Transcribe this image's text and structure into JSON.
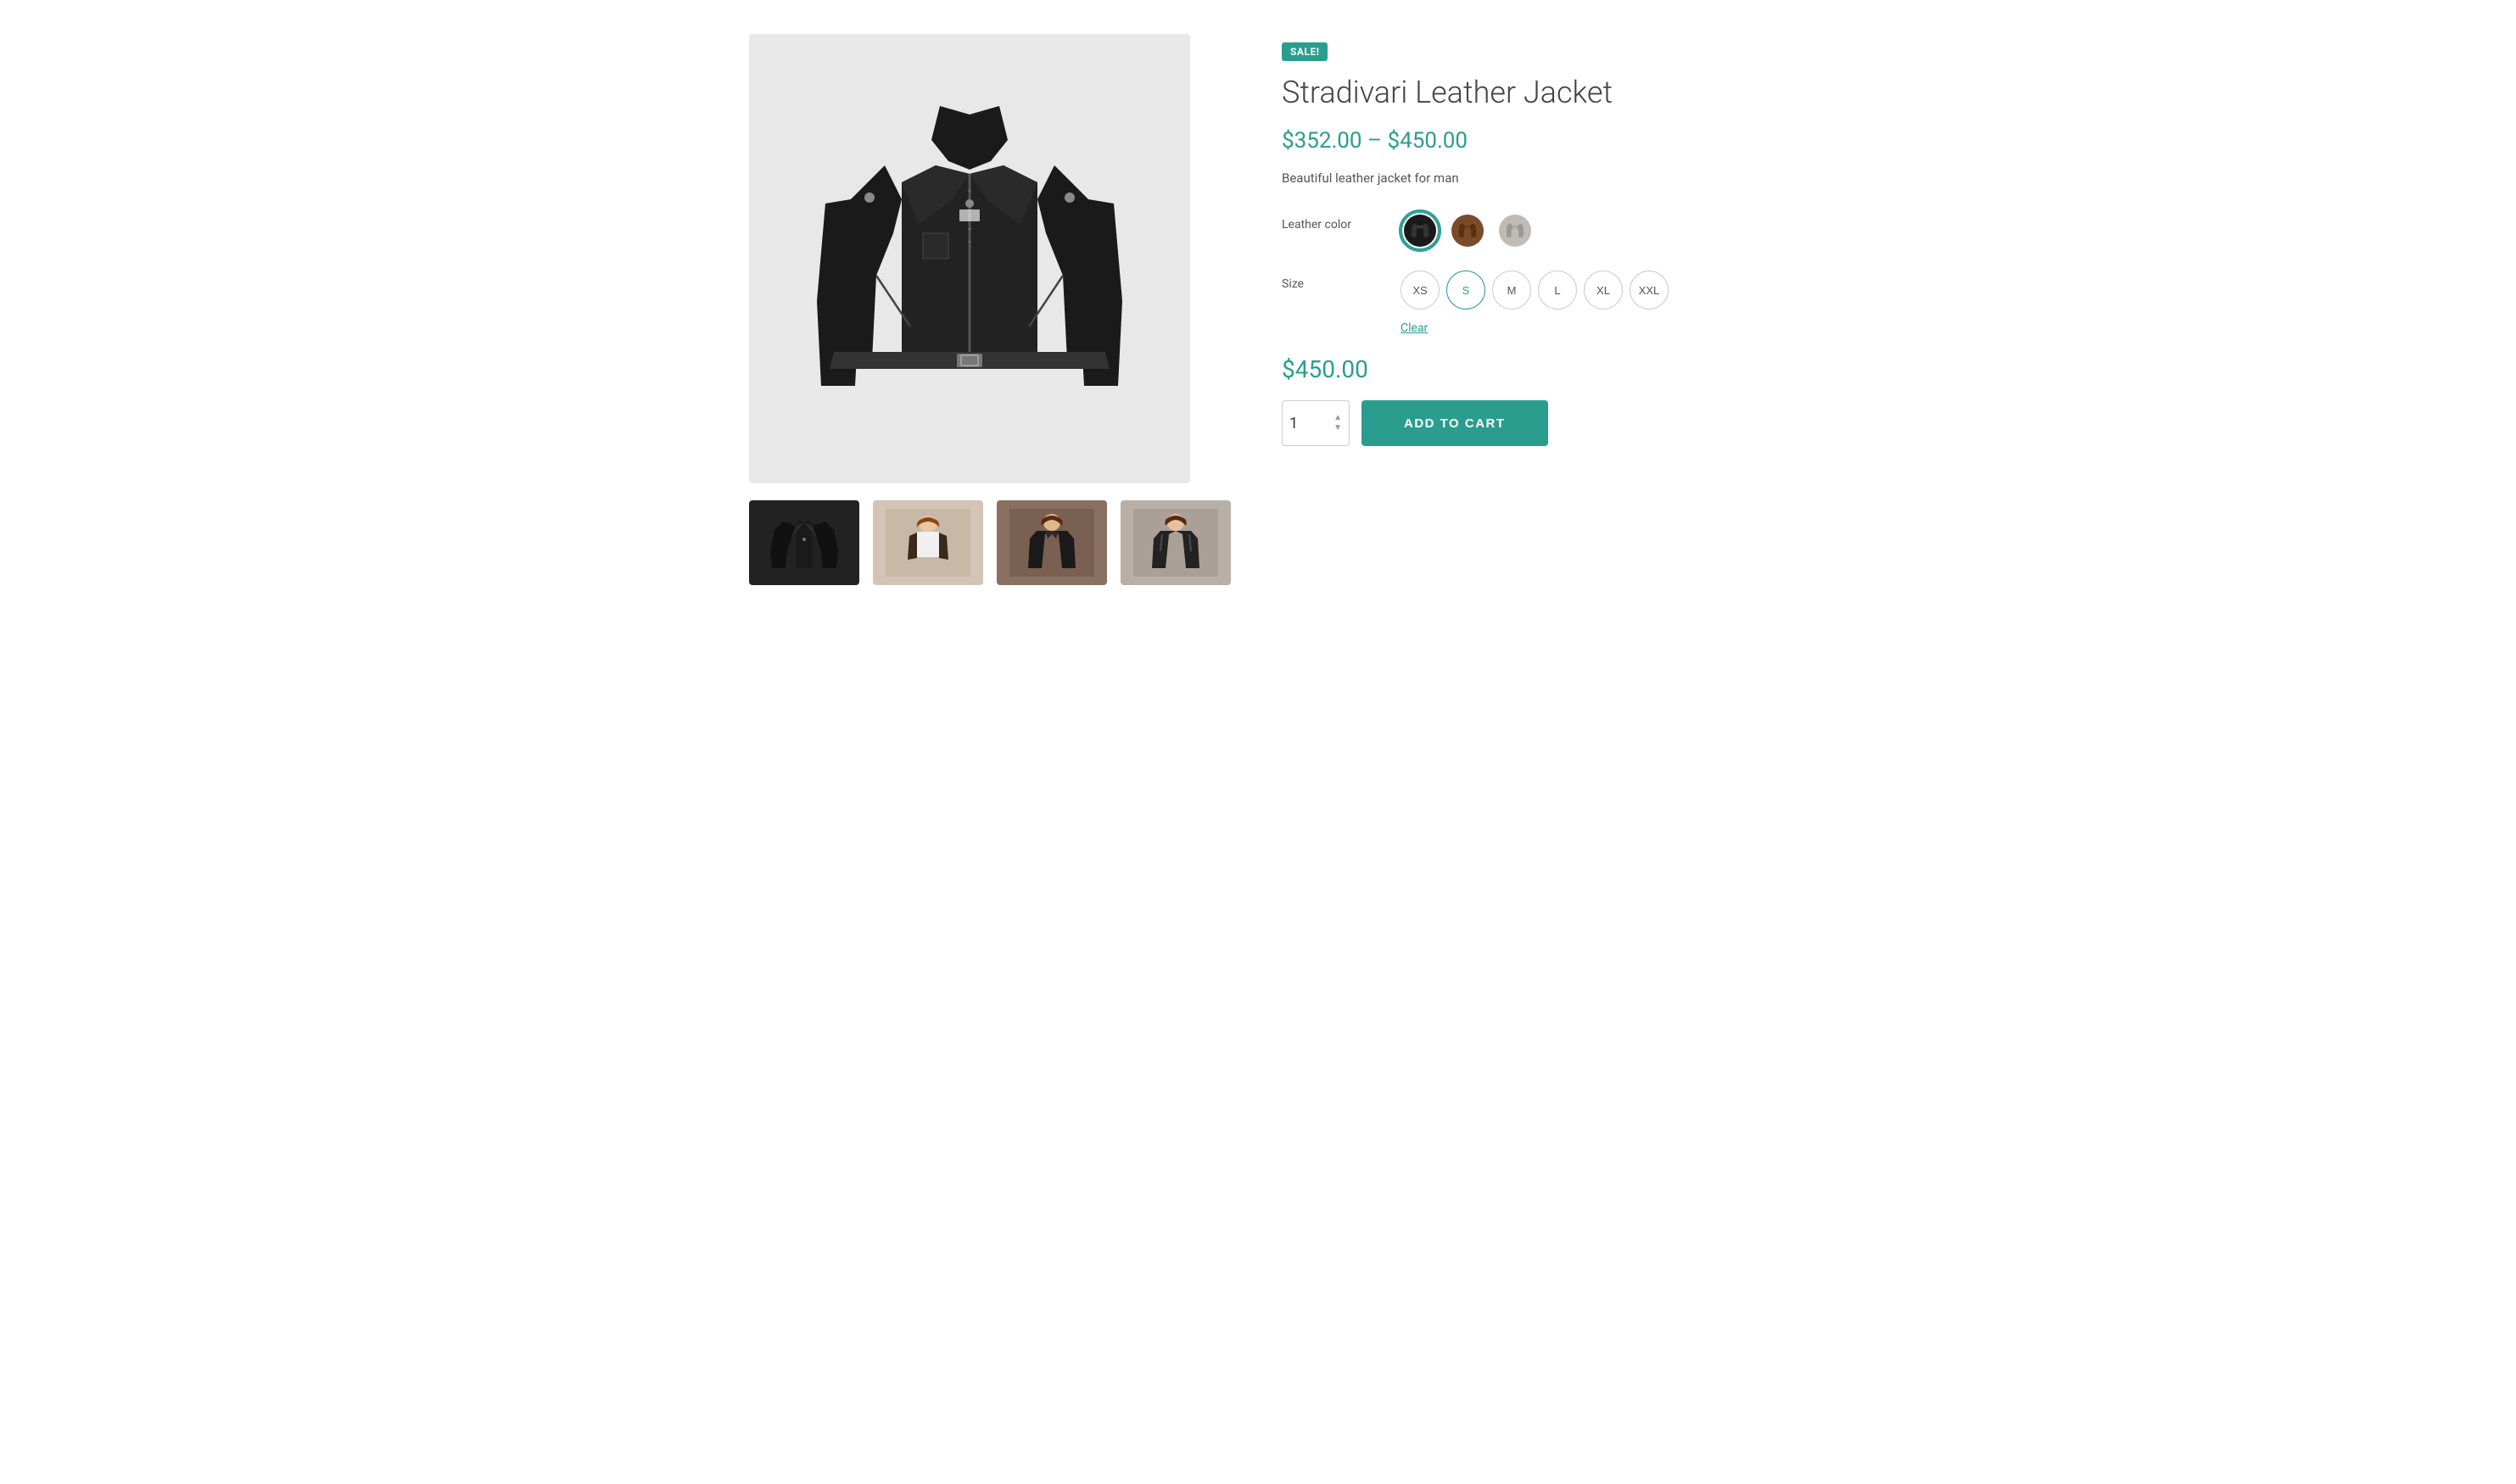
{
  "product": {
    "sale_badge": "SALE!",
    "title": "Stradivari Leather Jacket",
    "price_range": "$352.00 – $450.00",
    "description": "Beautiful leather jacket for man",
    "current_price": "$450.00",
    "quantity": "1"
  },
  "options": {
    "leather_color_label": "Leather color",
    "size_label": "Size",
    "colors": [
      {
        "id": "black",
        "label": "Black",
        "hex": "#1a1a1a",
        "active": true
      },
      {
        "id": "brown",
        "label": "Brown",
        "hex": "#7a4a2a",
        "active": false
      },
      {
        "id": "gray",
        "label": "Gray",
        "hex": "#c0bbb5",
        "active": false
      }
    ],
    "sizes": [
      {
        "label": "XS",
        "active": false
      },
      {
        "label": "S",
        "active": true
      },
      {
        "label": "M",
        "active": false
      },
      {
        "label": "L",
        "active": false
      },
      {
        "label": "XL",
        "active": false
      },
      {
        "label": "XXL",
        "active": false
      }
    ],
    "clear_label": "Clear"
  },
  "actions": {
    "add_to_cart_label": "ADD TO CART"
  },
  "colors": {
    "accent": "#2a9d8f",
    "sale_badge_bg": "#2a9d8f"
  }
}
